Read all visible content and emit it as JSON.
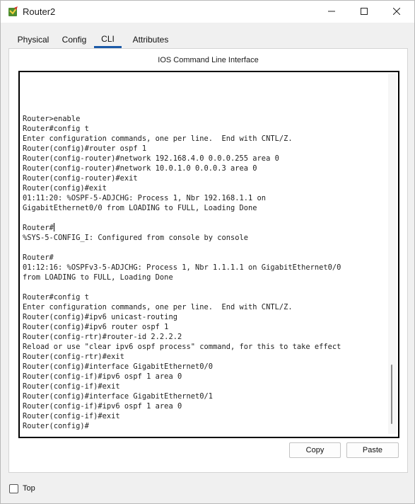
{
  "window": {
    "title": "Router2"
  },
  "tabs": [
    {
      "label": "Physical",
      "active": false
    },
    {
      "label": "Config",
      "active": false
    },
    {
      "label": "CLI",
      "active": true
    },
    {
      "label": "Attributes",
      "active": false
    }
  ],
  "panel": {
    "heading": "IOS Command Line Interface"
  },
  "console": {
    "lines": [
      "Router>enable",
      "Router#config t",
      "Enter configuration commands, one per line.  End with CNTL/Z.",
      "Router(config)#router ospf 1",
      "Router(config-router)#network 192.168.4.0 0.0.0.255 area 0",
      "Router(config-router)#network 10.0.1.0 0.0.0.3 area 0",
      "Router(config-router)#exit",
      "Router(config)#exit",
      "01:11:20: %OSPF-5-ADJCHG: Process 1, Nbr 192.168.1.1 on",
      "GigabitEthernet0/0 from LOADING to FULL, Loading Done",
      "",
      "Router#",
      "%SYS-5-CONFIG_I: Configured from console by console",
      "",
      "Router#",
      "01:12:16: %OSPFv3-5-ADJCHG: Process 1, Nbr 1.1.1.1 on GigabitEthernet0/0",
      "from LOADING to FULL, Loading Done",
      "",
      "Router#config t",
      "Enter configuration commands, one per line.  End with CNTL/Z.",
      "Router(config)#ipv6 unicast-routing",
      "Router(config)#ipv6 router ospf 1",
      "Router(config-rtr)#router-id 2.2.2.2",
      "Reload or use \"clear ipv6 ospf process\" command, for this to take effect",
      "Router(config-rtr)#exit",
      "Router(config)#interface GigabitEthernet0/0",
      "Router(config-if)#ipv6 ospf 1 area 0",
      "Router(config-if)#exit",
      "Router(config)#interface GigabitEthernet0/1",
      "Router(config-if)#ipv6 ospf 1 area 0",
      "Router(config-if)#exit",
      "Router(config)#"
    ]
  },
  "buttons": {
    "copy": "Copy",
    "paste": "Paste"
  },
  "footer": {
    "top_checkbox_label": "Top",
    "top_checked": false
  },
  "icons": {
    "app": "router-app-icon",
    "minimize": "minimize-icon",
    "maximize": "maximize-icon",
    "close": "close-icon"
  },
  "colors": {
    "active_tab_underline": "#1c5aa8"
  }
}
